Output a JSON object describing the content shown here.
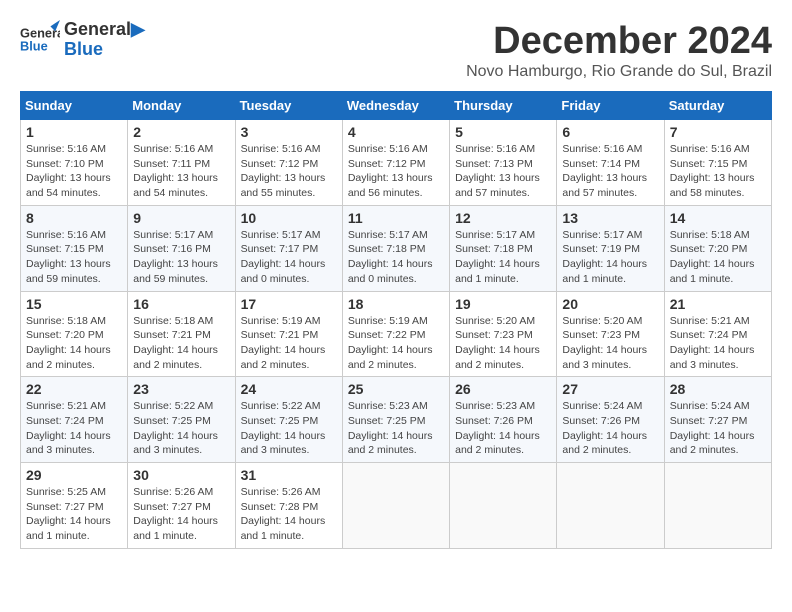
{
  "header": {
    "logo_line1": "General",
    "logo_line2": "Blue",
    "month": "December 2024",
    "location": "Novo Hamburgo, Rio Grande do Sul, Brazil"
  },
  "days_of_week": [
    "Sunday",
    "Monday",
    "Tuesday",
    "Wednesday",
    "Thursday",
    "Friday",
    "Saturday"
  ],
  "weeks": [
    [
      {
        "day": "1",
        "info": "Sunrise: 5:16 AM\nSunset: 7:10 PM\nDaylight: 13 hours\nand 54 minutes."
      },
      {
        "day": "2",
        "info": "Sunrise: 5:16 AM\nSunset: 7:11 PM\nDaylight: 13 hours\nand 54 minutes."
      },
      {
        "day": "3",
        "info": "Sunrise: 5:16 AM\nSunset: 7:12 PM\nDaylight: 13 hours\nand 55 minutes."
      },
      {
        "day": "4",
        "info": "Sunrise: 5:16 AM\nSunset: 7:12 PM\nDaylight: 13 hours\nand 56 minutes."
      },
      {
        "day": "5",
        "info": "Sunrise: 5:16 AM\nSunset: 7:13 PM\nDaylight: 13 hours\nand 57 minutes."
      },
      {
        "day": "6",
        "info": "Sunrise: 5:16 AM\nSunset: 7:14 PM\nDaylight: 13 hours\nand 57 minutes."
      },
      {
        "day": "7",
        "info": "Sunrise: 5:16 AM\nSunset: 7:15 PM\nDaylight: 13 hours\nand 58 minutes."
      }
    ],
    [
      {
        "day": "8",
        "info": "Sunrise: 5:16 AM\nSunset: 7:15 PM\nDaylight: 13 hours\nand 59 minutes."
      },
      {
        "day": "9",
        "info": "Sunrise: 5:17 AM\nSunset: 7:16 PM\nDaylight: 13 hours\nand 59 minutes."
      },
      {
        "day": "10",
        "info": "Sunrise: 5:17 AM\nSunset: 7:17 PM\nDaylight: 14 hours\nand 0 minutes."
      },
      {
        "day": "11",
        "info": "Sunrise: 5:17 AM\nSunset: 7:18 PM\nDaylight: 14 hours\nand 0 minutes."
      },
      {
        "day": "12",
        "info": "Sunrise: 5:17 AM\nSunset: 7:18 PM\nDaylight: 14 hours\nand 1 minute."
      },
      {
        "day": "13",
        "info": "Sunrise: 5:17 AM\nSunset: 7:19 PM\nDaylight: 14 hours\nand 1 minute."
      },
      {
        "day": "14",
        "info": "Sunrise: 5:18 AM\nSunset: 7:20 PM\nDaylight: 14 hours\nand 1 minute."
      }
    ],
    [
      {
        "day": "15",
        "info": "Sunrise: 5:18 AM\nSunset: 7:20 PM\nDaylight: 14 hours\nand 2 minutes."
      },
      {
        "day": "16",
        "info": "Sunrise: 5:18 AM\nSunset: 7:21 PM\nDaylight: 14 hours\nand 2 minutes."
      },
      {
        "day": "17",
        "info": "Sunrise: 5:19 AM\nSunset: 7:21 PM\nDaylight: 14 hours\nand 2 minutes."
      },
      {
        "day": "18",
        "info": "Sunrise: 5:19 AM\nSunset: 7:22 PM\nDaylight: 14 hours\nand 2 minutes."
      },
      {
        "day": "19",
        "info": "Sunrise: 5:20 AM\nSunset: 7:23 PM\nDaylight: 14 hours\nand 2 minutes."
      },
      {
        "day": "20",
        "info": "Sunrise: 5:20 AM\nSunset: 7:23 PM\nDaylight: 14 hours\nand 3 minutes."
      },
      {
        "day": "21",
        "info": "Sunrise: 5:21 AM\nSunset: 7:24 PM\nDaylight: 14 hours\nand 3 minutes."
      }
    ],
    [
      {
        "day": "22",
        "info": "Sunrise: 5:21 AM\nSunset: 7:24 PM\nDaylight: 14 hours\nand 3 minutes."
      },
      {
        "day": "23",
        "info": "Sunrise: 5:22 AM\nSunset: 7:25 PM\nDaylight: 14 hours\nand 3 minutes."
      },
      {
        "day": "24",
        "info": "Sunrise: 5:22 AM\nSunset: 7:25 PM\nDaylight: 14 hours\nand 3 minutes."
      },
      {
        "day": "25",
        "info": "Sunrise: 5:23 AM\nSunset: 7:25 PM\nDaylight: 14 hours\nand 2 minutes."
      },
      {
        "day": "26",
        "info": "Sunrise: 5:23 AM\nSunset: 7:26 PM\nDaylight: 14 hours\nand 2 minutes."
      },
      {
        "day": "27",
        "info": "Sunrise: 5:24 AM\nSunset: 7:26 PM\nDaylight: 14 hours\nand 2 minutes."
      },
      {
        "day": "28",
        "info": "Sunrise: 5:24 AM\nSunset: 7:27 PM\nDaylight: 14 hours\nand 2 minutes."
      }
    ],
    [
      {
        "day": "29",
        "info": "Sunrise: 5:25 AM\nSunset: 7:27 PM\nDaylight: 14 hours\nand 1 minute."
      },
      {
        "day": "30",
        "info": "Sunrise: 5:26 AM\nSunset: 7:27 PM\nDaylight: 14 hours\nand 1 minute."
      },
      {
        "day": "31",
        "info": "Sunrise: 5:26 AM\nSunset: 7:28 PM\nDaylight: 14 hours\nand 1 minute."
      },
      {
        "day": "",
        "info": ""
      },
      {
        "day": "",
        "info": ""
      },
      {
        "day": "",
        "info": ""
      },
      {
        "day": "",
        "info": ""
      }
    ]
  ]
}
